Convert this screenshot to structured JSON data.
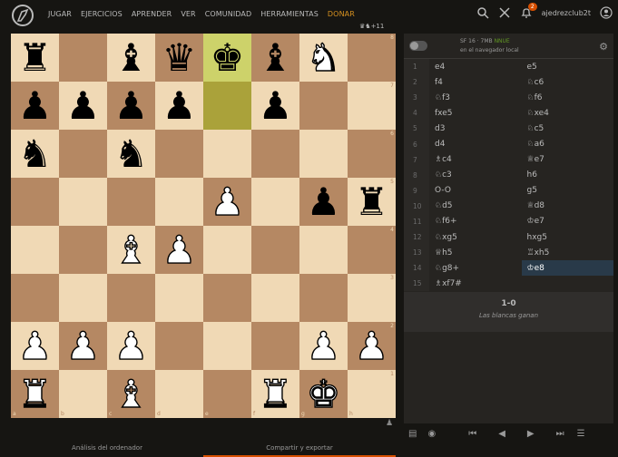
{
  "nav": {
    "items": [
      "JUGAR",
      "EJERCICIOS",
      "APRENDER",
      "VER",
      "COMUNIDAD",
      "HERRAMIENTAS"
    ],
    "donate": "DONAR",
    "notification_count": "2",
    "username": "ajedrezclub2t"
  },
  "board": {
    "captured_label": "+11",
    "ranks": [
      "8",
      "7",
      "6",
      "5",
      "4",
      "3",
      "2",
      "1"
    ],
    "files": [
      "a",
      "b",
      "c",
      "d",
      "e",
      "f",
      "g",
      "h"
    ],
    "position": [
      [
        "bR",
        "",
        "bB",
        "bQ",
        "bK",
        "bB",
        "wN",
        ""
      ],
      [
        "bP",
        "bP",
        "bP",
        "bP",
        "",
        "bP",
        "",
        ""
      ],
      [
        "bN",
        "",
        "bN",
        "",
        "",
        "",
        "",
        ""
      ],
      [
        "",
        "",
        "",
        "",
        "wP",
        "",
        "bP",
        "bR"
      ],
      [
        "",
        "",
        "wB",
        "wP",
        "",
        "",
        "",
        ""
      ],
      [
        "",
        "",
        "",
        "",
        "",
        "",
        "",
        ""
      ],
      [
        "wP",
        "wP",
        "wP",
        "",
        "",
        "",
        "wP",
        "wP"
      ],
      [
        "wR",
        "",
        "wB",
        "",
        "",
        "wR",
        "wK",
        ""
      ]
    ],
    "highlight": [
      "e8",
      "e7"
    ]
  },
  "engine": {
    "name": "SF 16 · 7MB",
    "nnue": "NNUE",
    "sub": "en el navegador local"
  },
  "moves": [
    {
      "n": "1",
      "w": "e4",
      "b": "e5"
    },
    {
      "n": "2",
      "w": "f4",
      "b": "♘c6"
    },
    {
      "n": "3",
      "w": "♘f3",
      "b": "♘f6"
    },
    {
      "n": "4",
      "w": "fxe5",
      "b": "♘xe4"
    },
    {
      "n": "5",
      "w": "d3",
      "b": "♘c5"
    },
    {
      "n": "6",
      "w": "d4",
      "b": "♘a6"
    },
    {
      "n": "7",
      "w": "♗c4",
      "b": "♕e7"
    },
    {
      "n": "8",
      "w": "♘c3",
      "b": "h6"
    },
    {
      "n": "9",
      "w": "O-O",
      "b": "g5"
    },
    {
      "n": "10",
      "w": "♘d5",
      "b": "♕d8"
    },
    {
      "n": "11",
      "w": "♘f6+",
      "b": "♔e7"
    },
    {
      "n": "12",
      "w": "♘xg5",
      "b": "hxg5"
    },
    {
      "n": "13",
      "w": "♕h5",
      "b": "♖xh5"
    },
    {
      "n": "14",
      "w": "♘g8+",
      "b": "♔e8"
    },
    {
      "n": "15",
      "w": "♗xf7#",
      "b": ""
    }
  ],
  "current_move": {
    "row": 13,
    "side": "b"
  },
  "result": {
    "score": "1-0",
    "text": "Las blancas ganan"
  },
  "bottom_tabs": [
    "Análisis del ordenador",
    "Compartir y exportar"
  ],
  "colors": {
    "accent": "#d64f00",
    "donate": "#d59020",
    "light_sq": "#f0d9b5",
    "dark_sq": "#b58863"
  }
}
